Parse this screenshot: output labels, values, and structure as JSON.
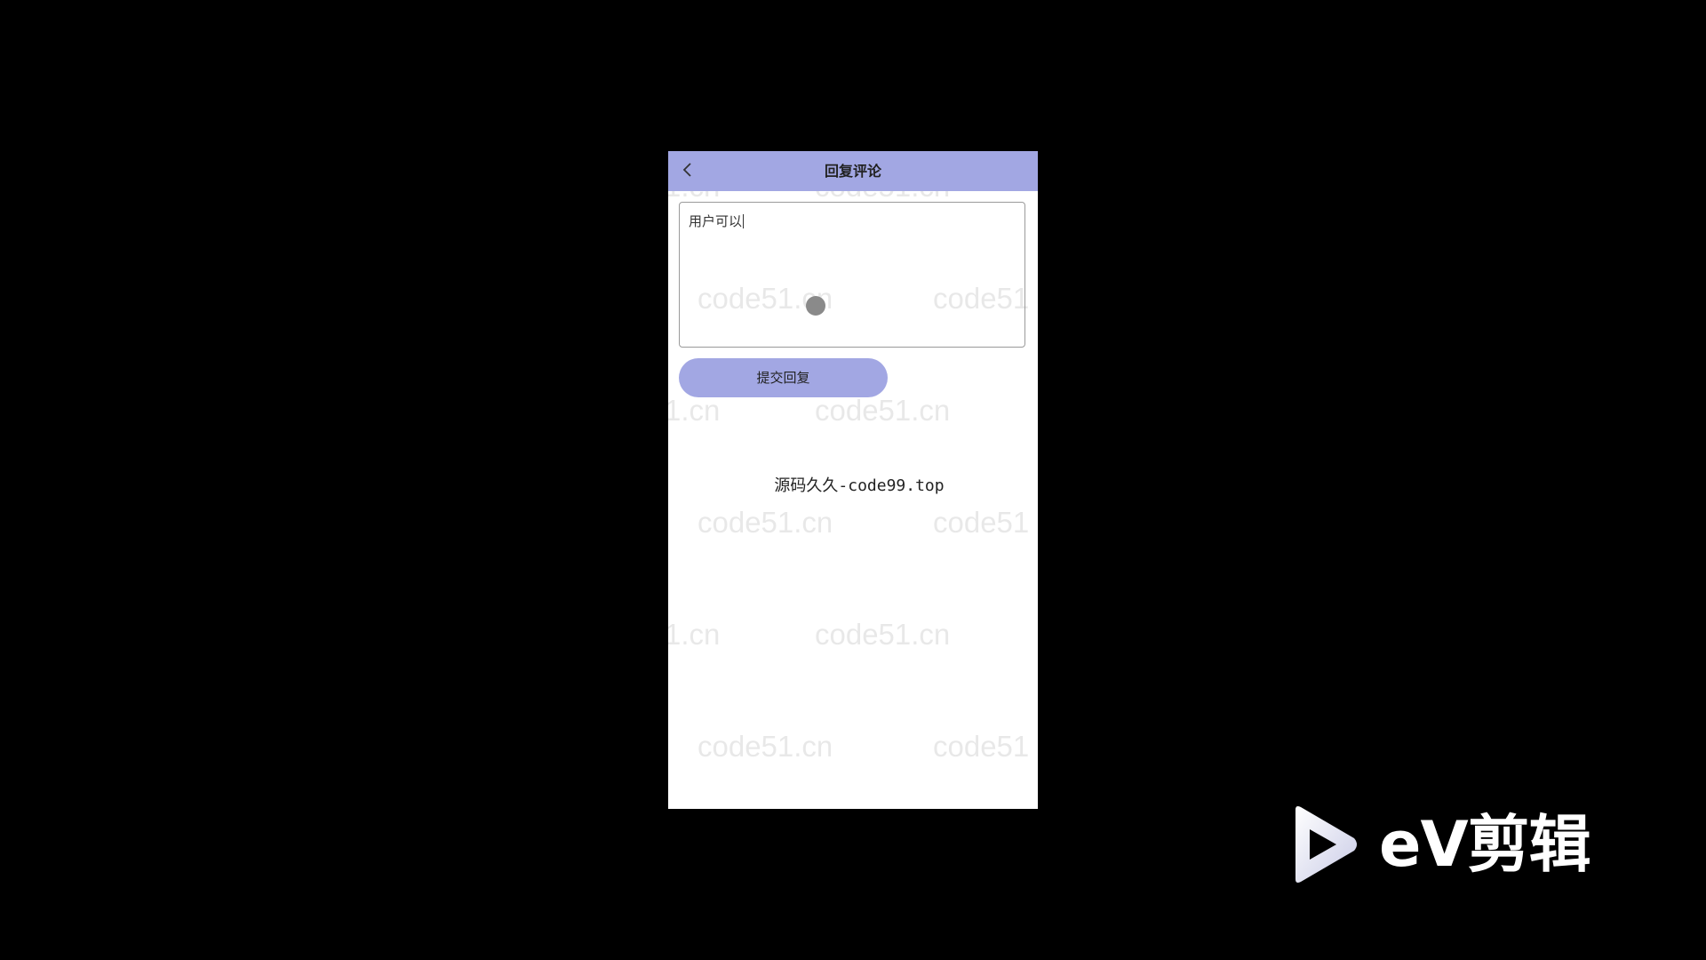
{
  "header": {
    "back_icon": "chevron-left-icon",
    "title": "回复评论",
    "background": "#a2a7e3"
  },
  "reply_form": {
    "textarea_value": "用户可以",
    "submit_label": "提交回复"
  },
  "footer": {
    "site_text": "源码久久-code99.top"
  },
  "watermark": {
    "text": "code51.cn",
    "partial_text": "1.cn",
    "edge_text": "code51"
  },
  "overlay_logo": {
    "text": "eV剪辑",
    "icon": "play-icon"
  }
}
